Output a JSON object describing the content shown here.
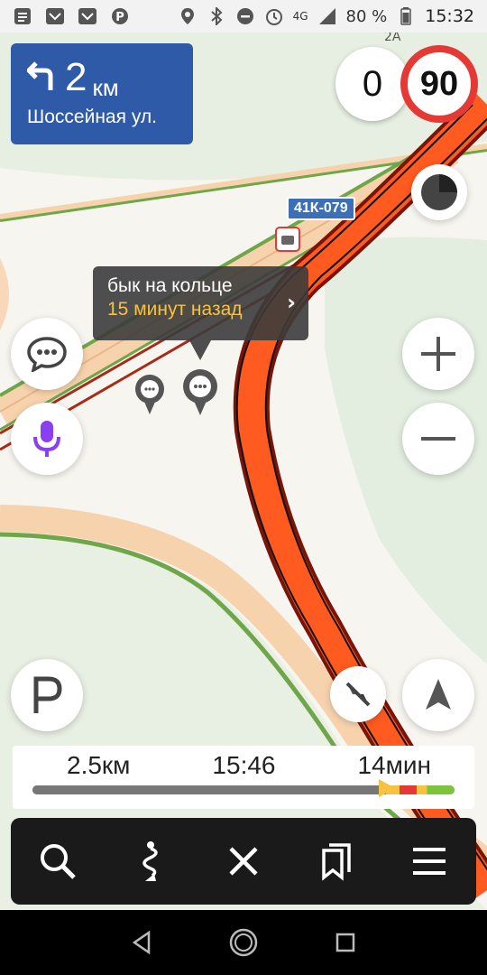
{
  "status_bar": {
    "battery_percent": "80 %",
    "time": "15:32",
    "network": "4G",
    "icons_left": [
      "notification-icon",
      "bank-icon",
      "bank-icon",
      "pinterest-icon"
    ],
    "icons_right": [
      "location-icon",
      "bluetooth-icon",
      "dnd-icon",
      "alarm-icon",
      "signal-icon",
      "battery-icon"
    ]
  },
  "map": {
    "building_label": "2А",
    "road_sign": "41К-079"
  },
  "direction": {
    "distance": "2",
    "unit": "км",
    "street": "Шоссейная ул.",
    "maneuver_icon": "turn-left-icon"
  },
  "speed": {
    "current": "0",
    "limit": "90"
  },
  "event": {
    "title": "бык на кольце",
    "time": "15 минут назад"
  },
  "trip": {
    "distance": "2.5км",
    "arrival": "15:46",
    "duration": "14мин",
    "progress_fraction": 0.84
  },
  "toolbar": {
    "items": [
      "search-icon",
      "route-icon",
      "close-icon",
      "bookmarks-icon",
      "menu-icon"
    ]
  },
  "nav": {
    "items": [
      "back-icon",
      "home-icon",
      "recents-icon"
    ]
  },
  "colors": {
    "route": "#ff5a1f",
    "direction_card": "#2e5aa8",
    "speed_limit_ring": "#e53935",
    "alice_purple": "#8a3ff0",
    "event_time": "#f5c242"
  }
}
